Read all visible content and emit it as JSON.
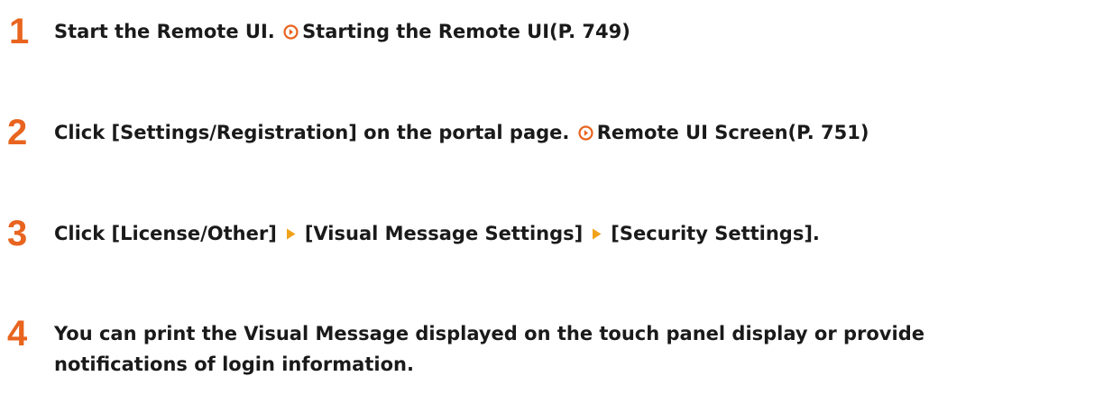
{
  "steps": [
    {
      "number": "1",
      "text": "Start the Remote UI.",
      "link": "Starting the Remote UI(P. 749)"
    },
    {
      "number": "2",
      "text": "Click [Settings/Registration] on the portal page.",
      "link": "Remote UI Screen(P. 751)"
    },
    {
      "number": "3",
      "parts": [
        "Click [License/Other]",
        "[Visual Message Settings]",
        "[Security Settings]."
      ]
    },
    {
      "number": "4",
      "text": "You can print the Visual Message displayed on the touch panel display or provide notifications of login information."
    }
  ],
  "colors": {
    "accent": "#e8641f",
    "text": "#1a1a1a"
  },
  "icons": {
    "link": "circle-arrow-right-icon",
    "separator": "triangle-right-icon"
  }
}
